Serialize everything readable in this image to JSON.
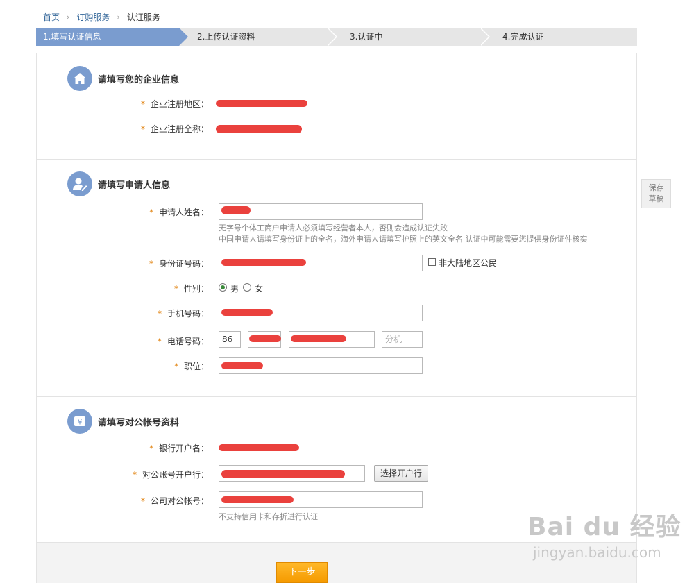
{
  "breadcrumb": [
    "首页",
    "订购服务",
    "认证服务"
  ],
  "steps": [
    "1.填写认证信息",
    "2.上传认证资料",
    "3.认证中",
    "4.完成认证"
  ],
  "save_draft": [
    "保存",
    "草稿"
  ],
  "required_mark": "*",
  "sections": {
    "company": {
      "title": "请填写您的企业信息",
      "icon": "house-icon"
    },
    "applicant": {
      "title": "请填写申请人信息",
      "icon": "user-edit-icon"
    },
    "account": {
      "title": "请填写对公帐号资料",
      "icon": "yen-card-icon"
    }
  },
  "company": {
    "region_label": "企业注册地区：",
    "fullname_label": "企业注册全称："
  },
  "applicant": {
    "name_label": "申请人姓名：",
    "name_hint_1": "无字号个体工商户申请人必须填写经营者本人，否则会造成认证失败",
    "name_hint_2": "中国申请人请填写身份证上的全名，海外申请人请填写护照上的英文全名 认证中可能需要您提供身份证件核实",
    "id_label": "身份证号码：",
    "non_mainland_label": "非大陆地区公民",
    "gender_label": "性别：",
    "gender_male": "男",
    "gender_female": "女",
    "gender_selected": "男",
    "mobile_label": "手机号码：",
    "phone_label": "电话号码：",
    "phone_country": "86",
    "phone_sep": "-",
    "phone_ext_placeholder": "分机",
    "position_label": "职位："
  },
  "account": {
    "holder_label": "银行开户名：",
    "bank_label": "对公账号开户行：",
    "choose_bank_button": "选择开户行",
    "number_label": "公司对公帐号：",
    "number_hint": "不支持信用卡和存折进行认证"
  },
  "next_button": "下一步",
  "watermark": {
    "logo": "Bai du 经验",
    "url": "jingyan.baidu.com"
  },
  "colors": {
    "accent": "#7a9ccf",
    "required": "#e07b00",
    "next_button": "#f7a400",
    "redaction": "#e8312d"
  }
}
